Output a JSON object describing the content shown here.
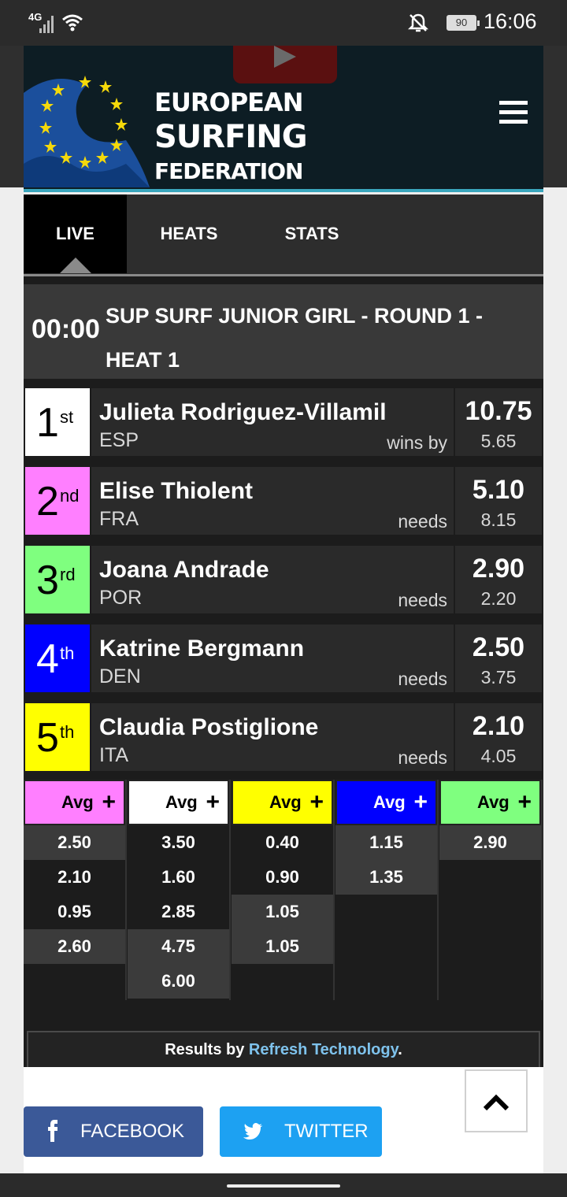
{
  "status_bar": {
    "network": "4G",
    "battery": "90",
    "time": "16:06"
  },
  "brand": {
    "line1": "EUROPEAN",
    "line2": "SURFING",
    "line3": "FEDERATION"
  },
  "tabs": [
    {
      "label": "LIVE"
    },
    {
      "label": "HEATS"
    },
    {
      "label": "STATS"
    }
  ],
  "heat": {
    "timer": "00:00",
    "title": "SUP SURF JUNIOR GIRL - ROUND 1 - HEAT 1"
  },
  "competitors": [
    {
      "place": "1",
      "suffix": "st",
      "color": "#ffffff",
      "name": "Julieta Rodriguez-Villamil",
      "country": "ESP",
      "status": "wins by",
      "score": "10.75",
      "diff": "5.65"
    },
    {
      "place": "2",
      "suffix": "nd",
      "color": "#ff7fff",
      "name": "Elise Thiolent",
      "country": "FRA",
      "status": "needs",
      "score": "5.10",
      "diff": "8.15"
    },
    {
      "place": "3",
      "suffix": "rd",
      "color": "#7fff7f",
      "name": "Joana Andrade",
      "country": "POR",
      "status": "needs",
      "score": "2.90",
      "diff": "2.20"
    },
    {
      "place": "4",
      "suffix": "th",
      "color": "#0000ff",
      "name": "Katrine Bergmann",
      "country": "DEN",
      "status": "needs",
      "score": "2.50",
      "diff": "3.75"
    },
    {
      "place": "5",
      "suffix": "th",
      "color": "#ffff00",
      "name": "Claudia Postiglione",
      "country": "ITA",
      "status": "needs",
      "score": "2.10",
      "diff": "4.05"
    }
  ],
  "wave_columns": [
    {
      "label": "Avg",
      "plus": "+",
      "color": "#ff7fff",
      "waves": [
        {
          "v": "2.50",
          "hl": true
        },
        {
          "v": "2.10",
          "hl": false
        },
        {
          "v": "0.95",
          "hl": false
        },
        {
          "v": "2.60",
          "hl": true
        }
      ]
    },
    {
      "label": "Avg",
      "plus": "+",
      "color": "#ffffff",
      "waves": [
        {
          "v": "3.50",
          "hl": false
        },
        {
          "v": "1.60",
          "hl": false
        },
        {
          "v": "2.85",
          "hl": false
        },
        {
          "v": "4.75",
          "hl": true
        },
        {
          "v": "6.00",
          "hl": true
        }
      ]
    },
    {
      "label": "Avg",
      "plus": "+",
      "color": "#ffff00",
      "waves": [
        {
          "v": "0.40",
          "hl": false
        },
        {
          "v": "0.90",
          "hl": false
        },
        {
          "v": "1.05",
          "hl": true
        },
        {
          "v": "1.05",
          "hl": true
        }
      ]
    },
    {
      "label": "Avg",
      "plus": "+",
      "color": "#0000ff",
      "waves": [
        {
          "v": "1.15",
          "hl": true
        },
        {
          "v": "1.35",
          "hl": true
        }
      ]
    },
    {
      "label": "Avg",
      "plus": "+",
      "color": "#7fff7f",
      "waves": [
        {
          "v": "2.90",
          "hl": true
        }
      ]
    }
  ],
  "credit": {
    "prefix": "Results by ",
    "link": "Refresh Technology",
    "suffix": "."
  },
  "share": {
    "facebook": "FACEBOOK",
    "twitter": "TWITTER"
  }
}
